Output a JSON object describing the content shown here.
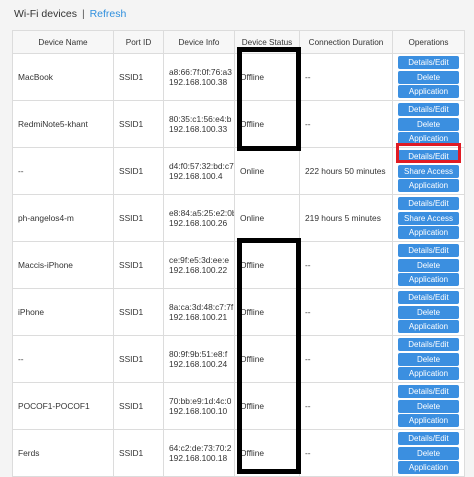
{
  "header": {
    "title": "Wi-Fi devices",
    "separator": "|",
    "refresh": "Refresh"
  },
  "columns": [
    "Device Name",
    "Port ID",
    "Device Info",
    "Device Status",
    "Connection Duration",
    "Operations"
  ],
  "rows": [
    {
      "name": "MacBook",
      "port": "SSID1",
      "mac": "a8:66:7f:0f:76:a3",
      "ip": "192.168.100.38",
      "status": "Offline",
      "duration": "--",
      "ops": [
        "Details/Edit",
        "Delete",
        "Application"
      ]
    },
    {
      "name": "RedmiNote5-khant",
      "port": "SSID1",
      "mac": "80:35:c1:56:e4:b",
      "ip": "192.168.100.33",
      "status": "Offline",
      "duration": "--",
      "ops": [
        "Details/Edit",
        "Delete",
        "Application"
      ]
    },
    {
      "name": "--",
      "port": "SSID1",
      "mac": "d4:f0:57:32:bd:c7",
      "ip": "192.168.100.4",
      "status": "Online",
      "duration": "222 hours 50 minutes",
      "ops": [
        "Details/Edit",
        "Share Access",
        "Application"
      ]
    },
    {
      "name": "ph-angelos4-m",
      "port": "SSID1",
      "mac": "e8:84:a5:25:e2:0b",
      "ip": "192.168.100.26",
      "status": "Online",
      "duration": "219 hours 5 minutes",
      "ops": [
        "Details/Edit",
        "Share Access",
        "Application"
      ]
    },
    {
      "name": "Maccis-iPhone",
      "port": "SSID1",
      "mac": "ce:9f:e5:3d:ee:e",
      "ip": "192.168.100.22",
      "status": "Offline",
      "duration": "--",
      "ops": [
        "Details/Edit",
        "Delete",
        "Application"
      ]
    },
    {
      "name": "iPhone",
      "port": "SSID1",
      "mac": "8a:ca:3d:48:c7:7f",
      "ip": "192.168.100.21",
      "status": "Offline",
      "duration": "--",
      "ops": [
        "Details/Edit",
        "Delete",
        "Application"
      ]
    },
    {
      "name": "--",
      "port": "SSID1",
      "mac": "80:9f:9b:51:e8:f",
      "ip": "192.168.100.24",
      "status": "Offline",
      "duration": "--",
      "ops": [
        "Details/Edit",
        "Delete",
        "Application"
      ]
    },
    {
      "name": "POCOF1-POCOF1",
      "port": "SSID1",
      "mac": "70:bb:e9:1d:4c:0",
      "ip": "192.168.100.10",
      "status": "Offline",
      "duration": "--",
      "ops": [
        "Details/Edit",
        "Delete",
        "Application"
      ]
    },
    {
      "name": "Ferds",
      "port": "SSID1",
      "mac": "64:c2:de:73:70:2",
      "ip": "192.168.100.18",
      "status": "Offline",
      "duration": "--",
      "ops": [
        "Details/Edit",
        "Delete",
        "Application"
      ]
    }
  ]
}
